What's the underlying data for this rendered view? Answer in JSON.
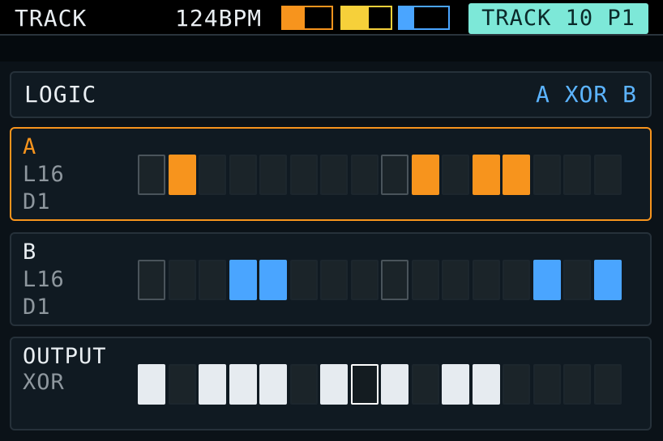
{
  "header": {
    "title": "TRACK",
    "bpm": "124BPM",
    "track_badge": "TRACK 10 P1"
  },
  "swatches": [
    {
      "name": "orange",
      "color": "#f7941d",
      "level": 0.45
    },
    {
      "name": "yellow",
      "color": "#f6d03a",
      "level": 0.55
    },
    {
      "name": "blue",
      "color": "#4aa5ff",
      "level": 0.3
    }
  ],
  "logic": {
    "label": "LOGIC",
    "value": "A XOR B"
  },
  "track_a": {
    "name": "A",
    "length": "L16",
    "division": "D1",
    "color": "#f7941d",
    "steps": [
      0,
      1,
      0,
      0,
      0,
      0,
      0,
      0,
      0,
      1,
      0,
      1,
      1,
      0,
      0,
      0
    ]
  },
  "track_b": {
    "name": "B",
    "length": "L16",
    "division": "D1",
    "color": "#4aa5ff",
    "steps": [
      0,
      0,
      0,
      1,
      1,
      0,
      0,
      0,
      0,
      0,
      0,
      0,
      0,
      1,
      0,
      1
    ]
  },
  "output": {
    "name": "OUTPUT",
    "mode": "XOR",
    "color": "#e6ebf0",
    "steps": [
      1,
      0,
      1,
      1,
      1,
      0,
      1,
      0,
      1,
      0,
      1,
      1,
      0,
      0,
      0,
      0
    ],
    "playhead_step": 7
  },
  "beat_steps": [
    0,
    8
  ]
}
